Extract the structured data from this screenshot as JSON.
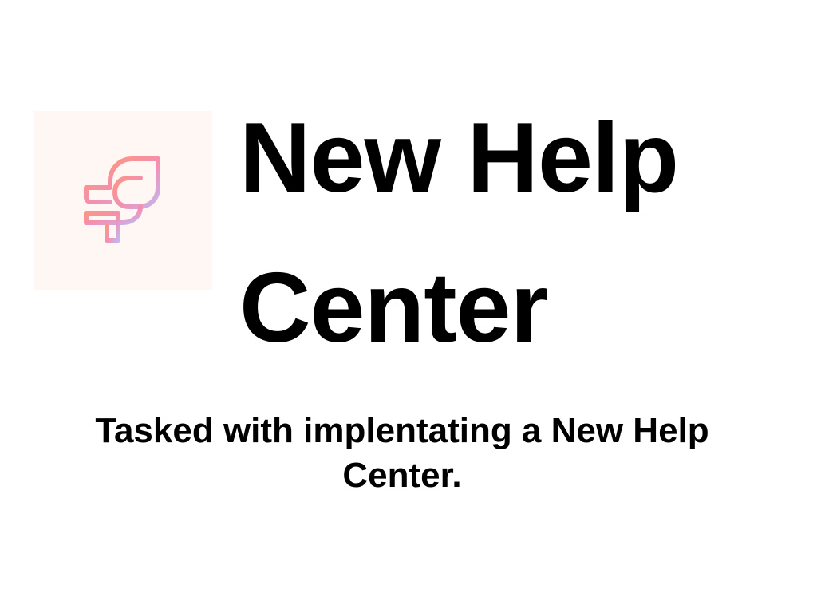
{
  "slide": {
    "title_line1": "New Help",
    "title_line2": "Center",
    "subtitle": "Tasked with implentating a New Help Center."
  },
  "logo": {
    "icon": "feather-logo-icon",
    "gradient_start": "#ff9a6b",
    "gradient_mid": "#f48fb1",
    "gradient_end": "#c4b5f0",
    "tile_background": "#fff7f4"
  },
  "colors": {
    "text": "#000000",
    "divider": "#000000",
    "background": "#ffffff"
  }
}
